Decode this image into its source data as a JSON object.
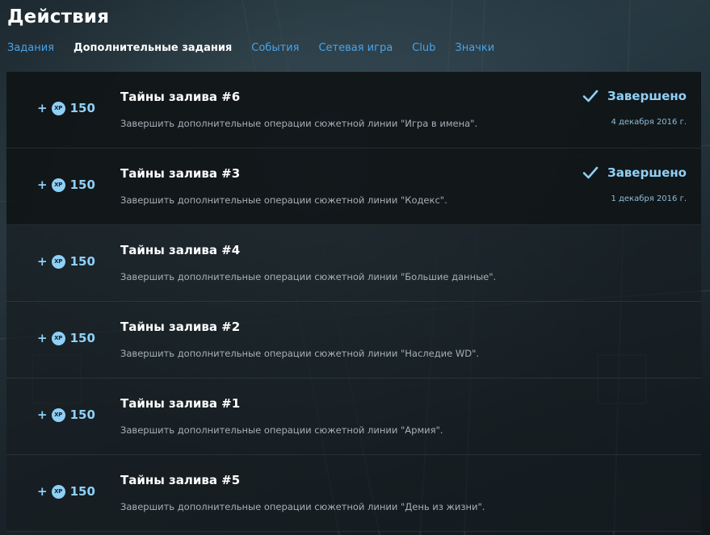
{
  "header": {
    "title": "Действия"
  },
  "tabs": [
    {
      "label": "Задания",
      "active": false
    },
    {
      "label": "Дополнительные задания",
      "active": true
    },
    {
      "label": "События",
      "active": false
    },
    {
      "label": "Сетевая игра",
      "active": false
    },
    {
      "label": "Club",
      "active": false
    },
    {
      "label": "Значки",
      "active": false
    }
  ],
  "reward_icon_text": "XP",
  "rows": [
    {
      "reward_plus": "+",
      "reward_value": "150",
      "title": "Тайны залива #6",
      "description": "Завершить дополнительные операции сюжетной линии \"Игра в имена\".",
      "status": "Завершено",
      "date": "4 декабря 2016 г.",
      "completed": true
    },
    {
      "reward_plus": "+",
      "reward_value": "150",
      "title": "Тайны залива #3",
      "description": "Завершить дополнительные операции сюжетной линии \"Кодекс\".",
      "status": "Завершено",
      "date": "1 декабря 2016 г.",
      "completed": true
    },
    {
      "reward_plus": "+",
      "reward_value": "150",
      "title": "Тайны залива #4",
      "description": "Завершить дополнительные операции сюжетной линии \"Большие данные\".",
      "completed": false
    },
    {
      "reward_plus": "+",
      "reward_value": "150",
      "title": "Тайны залива #2",
      "description": "Завершить дополнительные операции сюжетной линии \"Наследие WD\".",
      "completed": false
    },
    {
      "reward_plus": "+",
      "reward_value": "150",
      "title": "Тайны залива #1",
      "description": "Завершить дополнительные операции сюжетной линии \"Армия\".",
      "completed": false
    },
    {
      "reward_plus": "+",
      "reward_value": "150",
      "title": "Тайны залива #5",
      "description": "Завершить дополнительные операции сюжетной линии \"День из жизни\".",
      "completed": false
    }
  ],
  "colors": {
    "accent": "#8fd0f6",
    "tab_link": "#4aa3e8",
    "description": "#a7b0b6"
  }
}
